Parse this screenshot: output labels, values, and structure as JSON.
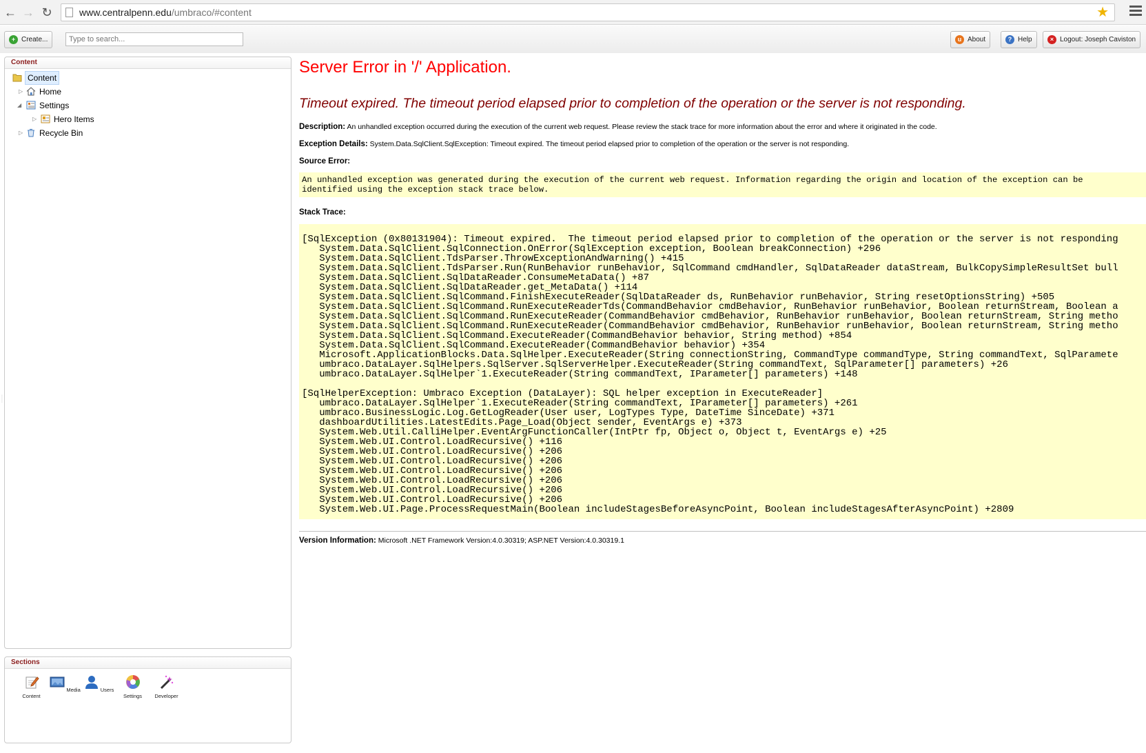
{
  "browser": {
    "url_domain": "www.centralpenn.edu",
    "url_path": "/umbraco/#content"
  },
  "toolbar": {
    "create_label": "Create...",
    "search_placeholder": "Type to search...",
    "about_label": "About",
    "help_label": "Help",
    "logout_label": "Logout: Joseph Caviston"
  },
  "content_panel": {
    "title": "Content",
    "tree": {
      "root": "Content",
      "home": "Home",
      "settings": "Settings",
      "hero_items": "Hero Items",
      "recycle_bin": "Recycle Bin"
    }
  },
  "sections_panel": {
    "title": "Sections",
    "items": [
      "Content",
      "Media",
      "Users",
      "Settings",
      "Developer"
    ]
  },
  "error": {
    "title": "Server Error in '/' Application.",
    "subtitle": "Timeout expired.  The timeout period elapsed prior to completion of the operation or the server is not responding.",
    "description_label": "Description:",
    "description_text": "An unhandled exception occurred during the execution of the current web request. Please review the stack trace for more information about the error and where it originated in the code.",
    "exception_label": "Exception Details:",
    "exception_text": "System.Data.SqlClient.SqlException: Timeout expired.  The timeout period elapsed prior to completion of the operation or the server is not responding.",
    "source_error_label": "Source Error:",
    "source_error_line1": "An unhandled exception was generated during the execution of the current web request. Information regarding the origin and location of the exception can be",
    "source_error_line2": "identified using the exception stack trace below.",
    "stack_trace_label": "Stack Trace:",
    "stack_trace": [
      "[SqlException (0x80131904): Timeout expired.  The timeout period elapsed prior to completion of the operation or the server is not responding",
      "   System.Data.SqlClient.SqlConnection.OnError(SqlException exception, Boolean breakConnection) +296",
      "   System.Data.SqlClient.TdsParser.ThrowExceptionAndWarning() +415",
      "   System.Data.SqlClient.TdsParser.Run(RunBehavior runBehavior, SqlCommand cmdHandler, SqlDataReader dataStream, BulkCopySimpleResultSet bull",
      "   System.Data.SqlClient.SqlDataReader.ConsumeMetaData() +87",
      "   System.Data.SqlClient.SqlDataReader.get_MetaData() +114",
      "   System.Data.SqlClient.SqlCommand.FinishExecuteReader(SqlDataReader ds, RunBehavior runBehavior, String resetOptionsString) +505",
      "   System.Data.SqlClient.SqlCommand.RunExecuteReaderTds(CommandBehavior cmdBehavior, RunBehavior runBehavior, Boolean returnStream, Boolean a",
      "   System.Data.SqlClient.SqlCommand.RunExecuteReader(CommandBehavior cmdBehavior, RunBehavior runBehavior, Boolean returnStream, String metho",
      "   System.Data.SqlClient.SqlCommand.RunExecuteReader(CommandBehavior cmdBehavior, RunBehavior runBehavior, Boolean returnStream, String metho",
      "   System.Data.SqlClient.SqlCommand.ExecuteReader(CommandBehavior behavior, String method) +854",
      "   System.Data.SqlClient.SqlCommand.ExecuteReader(CommandBehavior behavior) +354",
      "   Microsoft.ApplicationBlocks.Data.SqlHelper.ExecuteReader(String connectionString, CommandType commandType, String commandText, SqlParamete",
      "   umbraco.DataLayer.SqlHelpers.SqlServer.SqlServerHelper.ExecuteReader(String commandText, SqlParameter[] parameters) +26",
      "   umbraco.DataLayer.SqlHelper`1.ExecuteReader(String commandText, IParameter[] parameters) +148",
      "",
      "[SqlHelperException: Umbraco Exception (DataLayer): SQL helper exception in ExecuteReader]",
      "   umbraco.DataLayer.SqlHelper`1.ExecuteReader(String commandText, IParameter[] parameters) +261",
      "   umbraco.BusinessLogic.Log.GetLogReader(User user, LogTypes Type, DateTime SinceDate) +371",
      "   dashboardUtilities.LatestEdits.Page_Load(Object sender, EventArgs e) +373",
      "   System.Web.Util.CalliHelper.EventArgFunctionCaller(IntPtr fp, Object o, Object t, EventArgs e) +25",
      "   System.Web.UI.Control.LoadRecursive() +116",
      "   System.Web.UI.Control.LoadRecursive() +206",
      "   System.Web.UI.Control.LoadRecursive() +206",
      "   System.Web.UI.Control.LoadRecursive() +206",
      "   System.Web.UI.Control.LoadRecursive() +206",
      "   System.Web.UI.Control.LoadRecursive() +206",
      "   System.Web.UI.Control.LoadRecursive() +206",
      "   System.Web.UI.Page.ProcessRequestMain(Boolean includeStagesBeforeAsyncPoint, Boolean includeStagesAfterAsyncPoint) +2809"
    ],
    "version_label": "Version Information:",
    "version_text": "Microsoft .NET Framework Version:4.0.30319; ASP.NET Version:4.0.30319.1"
  }
}
